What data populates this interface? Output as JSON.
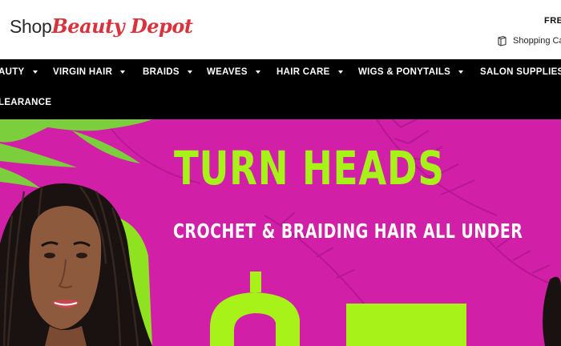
{
  "header": {
    "logo_shop": "Shop",
    "logo_brand": "Beauty Depot",
    "free_text": "FRE",
    "cart_label": "Shopping Ca"
  },
  "nav": {
    "items": [
      {
        "label": "AUTY",
        "has_caret": true
      },
      {
        "label": "VIRGIN HAIR",
        "has_caret": true
      },
      {
        "label": "BRAIDS",
        "has_caret": true
      },
      {
        "label": "WEAVES",
        "has_caret": true
      },
      {
        "label": "HAIR CARE",
        "has_caret": true
      },
      {
        "label": "WIGS & PONYTAILS",
        "has_caret": true
      },
      {
        "label": "SALON SUPPLIES",
        "has_caret": false
      },
      {
        "label": "LEARANCE",
        "has_caret": false
      }
    ]
  },
  "hero": {
    "headline": "TURN HEADS",
    "subline": "CROCHET & BRAIDING HAIR ALL UNDER",
    "colors": {
      "background": "#d11fa8",
      "headline": "#a6f219",
      "subline": "#ffffff"
    }
  },
  "icons": {
    "cart": "shopping-bag-icon",
    "caret": "chevron-down-icon"
  }
}
